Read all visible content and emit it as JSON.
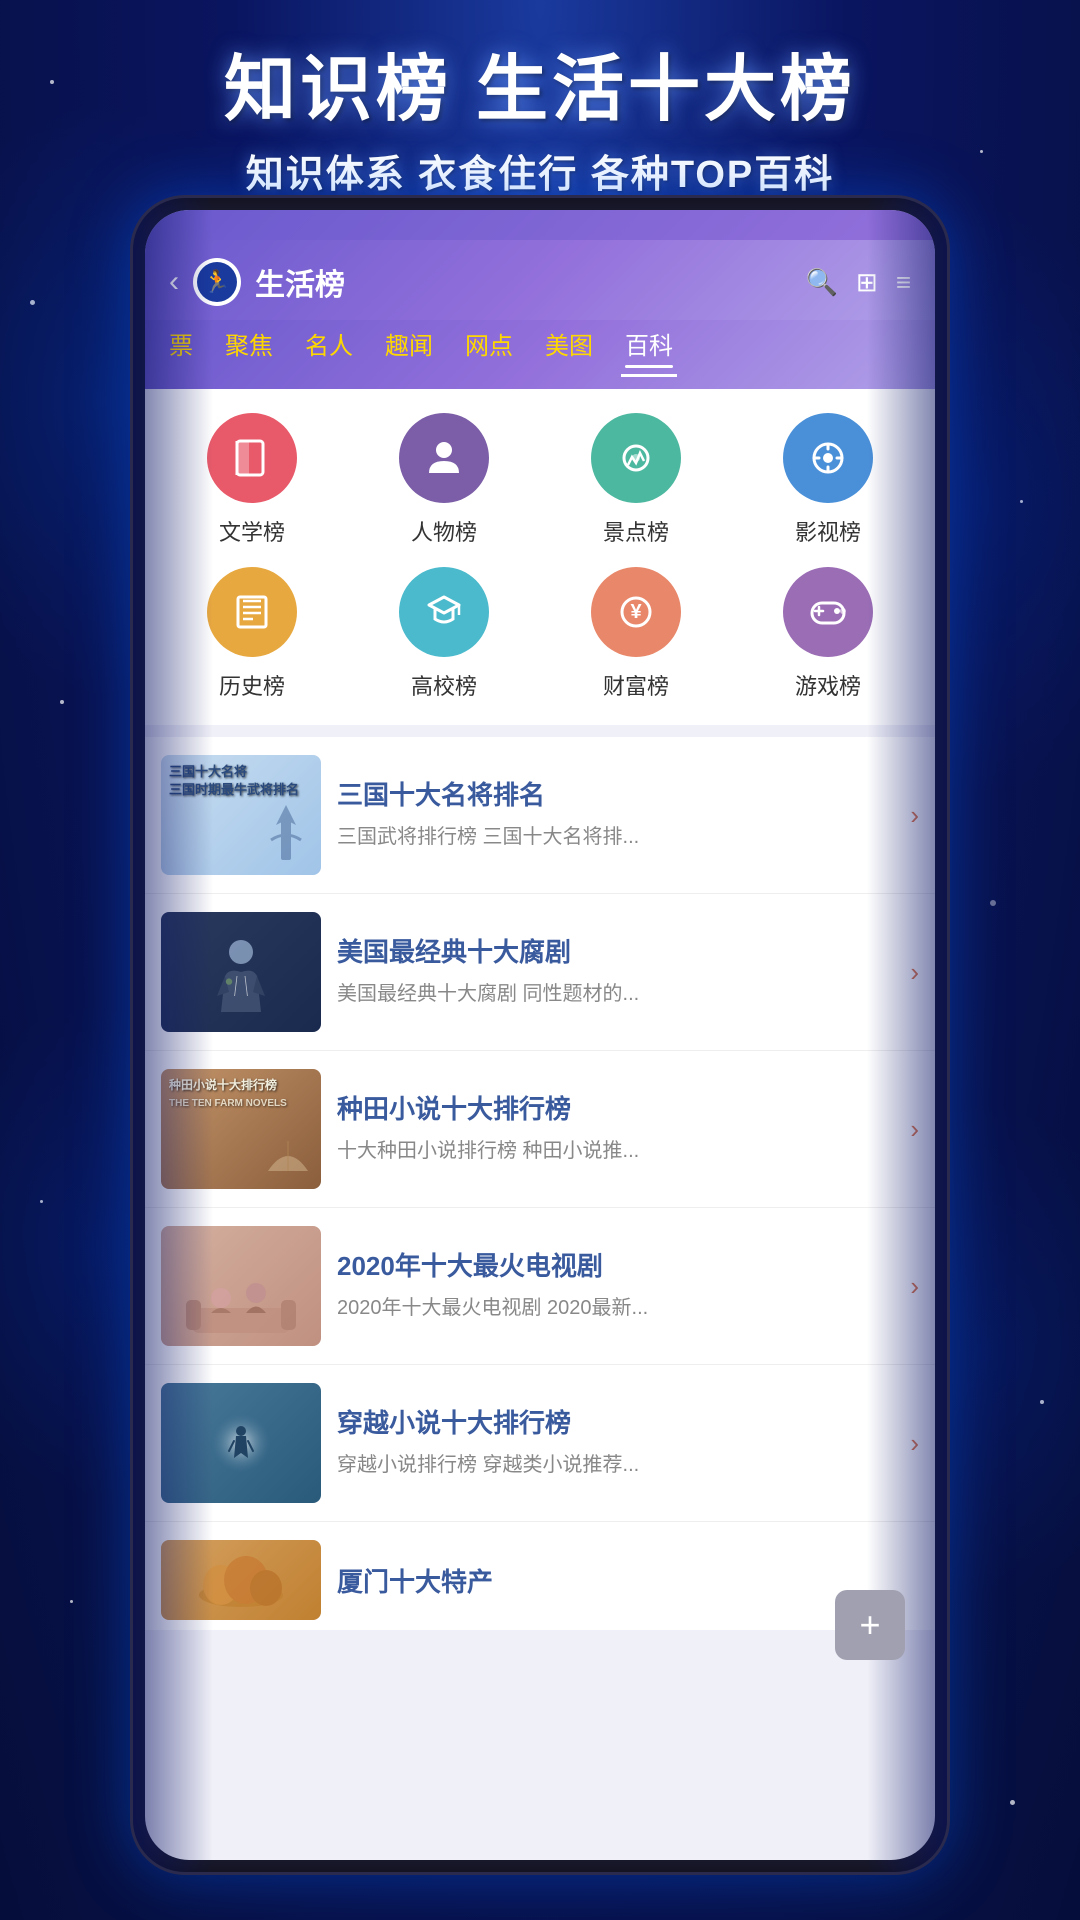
{
  "hero": {
    "title": "知识榜 生活十大榜",
    "subtitle": "知识体系 衣食住行 各种TOP百科"
  },
  "header": {
    "back_label": "‹",
    "app_name": "生活榜",
    "search_icon": "🔍",
    "grid_icon": "⊞",
    "list_icon": "≡"
  },
  "tabs": [
    {
      "label": "票",
      "active": false
    },
    {
      "label": "聚焦",
      "active": false
    },
    {
      "label": "名人",
      "active": false
    },
    {
      "label": "趣闻",
      "active": false
    },
    {
      "label": "网点",
      "active": false
    },
    {
      "label": "美图",
      "active": false
    },
    {
      "label": "百科",
      "active": true
    }
  ],
  "categories": [
    {
      "icon": "📚",
      "label": "文学榜",
      "color": "cat-red"
    },
    {
      "icon": "👤",
      "label": "人物榜",
      "color": "cat-purple"
    },
    {
      "icon": "🏔",
      "label": "景点榜",
      "color": "cat-teal"
    },
    {
      "icon": "🎬",
      "label": "影视榜",
      "color": "cat-blue"
    },
    {
      "icon": "📜",
      "label": "历史榜",
      "color": "cat-orange"
    },
    {
      "icon": "🎓",
      "label": "高校榜",
      "color": "cat-cyan"
    },
    {
      "icon": "💰",
      "label": "财富榜",
      "color": "cat-salmon"
    },
    {
      "icon": "🎮",
      "label": "游戏榜",
      "color": "cat-violet"
    }
  ],
  "list_items": [
    {
      "title": "三国十大名将排名",
      "desc": "三国武将排行榜 三国十大名将排...",
      "thumb_label": "三国十大名将\n三国时期最牛武将排名",
      "thumb_class": "thumb-bg-1"
    },
    {
      "title": "美国最经典十大腐剧",
      "desc": "美国最经典十大腐剧 同性题材的...",
      "thumb_label": "",
      "thumb_class": "thumb-bg-2"
    },
    {
      "title": "种田小说十大排行榜",
      "desc": "十大种田小说排行榜 种田小说推...",
      "thumb_label": "种田小说十大排行榜\nTHE TEN FARM NOVELS",
      "thumb_class": "thumb-bg-3"
    },
    {
      "title": "2020年十大最火电视剧",
      "desc": "2020年十大最火电视剧 2020最新...",
      "thumb_label": "",
      "thumb_class": "thumb-bg-4"
    },
    {
      "title": "穿越小说十大排行榜",
      "desc": "穿越小说排行榜 穿越类小说推荐...",
      "thumb_label": "",
      "thumb_class": "thumb-bg-5"
    }
  ],
  "partial_item": {
    "title": "厦门十大特产",
    "thumb_class": "thumb-bg-6"
  },
  "float_button": {
    "icon": "+"
  }
}
